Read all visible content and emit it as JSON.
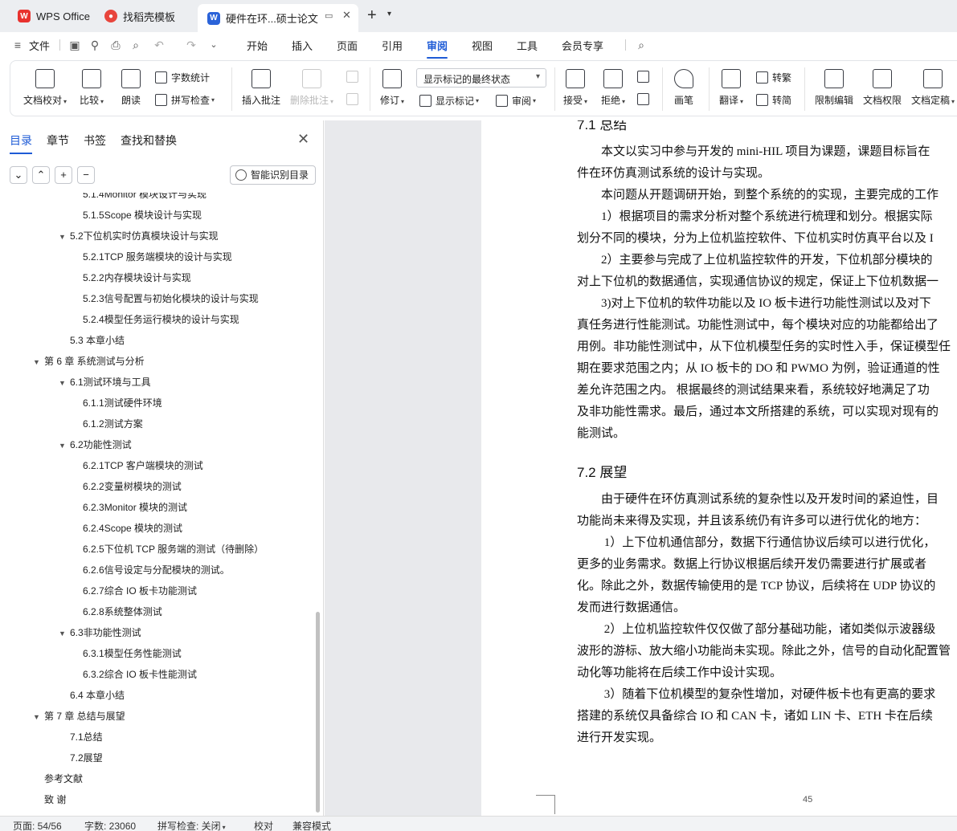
{
  "titlebar": {
    "tabs": [
      {
        "label": "WPS Office",
        "icon": "wps-logo-icon",
        "color": "#e8322e"
      },
      {
        "label": "找稻壳模板",
        "icon": "docer-logo-icon",
        "color": "#e8453c"
      },
      {
        "label": "硬件在环...硕士论文",
        "icon": "word-doc-icon",
        "color": "#2b63d9"
      }
    ],
    "new_tab_glyph": "+"
  },
  "menubar": {
    "file_label": "文件",
    "items": [
      "开始",
      "插入",
      "页面",
      "引用",
      "审阅",
      "视图",
      "工具",
      "会员专享"
    ],
    "active": "审阅"
  },
  "ribbon": {
    "doc_proof": "文档校对",
    "compare": "比较",
    "read_aloud": "朗读",
    "word_count": "字数统计",
    "spell_check": "拼写检查",
    "insert_comment": "插入批注",
    "delete_comment": "删除批注",
    "track_changes": "修订",
    "markup_state": "显示标记的最终状态",
    "show_markup": "显示标记",
    "review": "审阅",
    "accept": "接受",
    "reject": "拒绝",
    "pen": "画笔",
    "translate": "翻译",
    "to_traditional": "转繁",
    "to_simplified": "转简",
    "restrict_edit": "限制编辑",
    "doc_permission": "文档权限",
    "doc_finalize": "文档定稿"
  },
  "nav_pane": {
    "tabs": [
      "目录",
      "章节",
      "书签",
      "查找和替换"
    ],
    "active_tab": "目录",
    "smart_toc_button": "智能识别目录",
    "toc": [
      {
        "text": "5.1.4Monitor 模块设计与实现",
        "level": 3
      },
      {
        "text": "5.1.5Scope 模块设计与实现",
        "level": 3
      },
      {
        "text": "5.2下位机实时仿真模块设计与实现",
        "level": 2,
        "expanded": true
      },
      {
        "text": "5.2.1TCP 服务端模块的设计与实现",
        "level": 3
      },
      {
        "text": "5.2.2内存模块设计与实现",
        "level": 3
      },
      {
        "text": "5.2.3信号配置与初始化模块的设计与实现",
        "level": 3
      },
      {
        "text": "5.2.4模型任务运行模块的设计与实现",
        "level": 3
      },
      {
        "text": "5.3 本章小结",
        "level": 2
      },
      {
        "text": "第 6 章 系统测试与分析",
        "level": 1,
        "expanded": true
      },
      {
        "text": "6.1测试环境与工具",
        "level": 2,
        "expanded": true
      },
      {
        "text": "6.1.1测试硬件环境",
        "level": 3
      },
      {
        "text": "6.1.2测试方案",
        "level": 3
      },
      {
        "text": "6.2功能性测试",
        "level": 2,
        "expanded": true
      },
      {
        "text": "6.2.1TCP 客户端模块的测试",
        "level": 3
      },
      {
        "text": "6.2.2变量树模块的测试",
        "level": 3
      },
      {
        "text": "6.2.3Monitor 模块的测试",
        "level": 3
      },
      {
        "text": "6.2.4Scope 模块的测试",
        "level": 3
      },
      {
        "text": "6.2.5下位机 TCP 服务端的测试（待删除）",
        "level": 3
      },
      {
        "text": "6.2.6信号设定与分配模块的测试。",
        "level": 3
      },
      {
        "text": "6.2.7综合 IO 板卡功能测试",
        "level": 3
      },
      {
        "text": "6.2.8系统整体测试",
        "level": 3
      },
      {
        "text": "6.3非功能性测试",
        "level": 2,
        "expanded": true
      },
      {
        "text": "6.3.1模型任务性能测试",
        "level": 3
      },
      {
        "text": "6.3.2综合 IO 板卡性能测试",
        "level": 3
      },
      {
        "text": "6.4 本章小结",
        "level": 2
      },
      {
        "text": "第 7 章 总结与展望",
        "level": 1,
        "expanded": true
      },
      {
        "text": "7.1总结",
        "level": 2
      },
      {
        "text": "7.2展望",
        "level": 2
      },
      {
        "text": "参考文献",
        "level": 1
      },
      {
        "text": "致 谢",
        "level": 1
      }
    ]
  },
  "document": {
    "lines": [
      {
        "kind": "heading",
        "text": "7.1 总结"
      },
      {
        "kind": "text",
        "text": "　　本文以实习中参与开发的 mini-HIL 项目为课题，课题目标旨在"
      },
      {
        "kind": "text",
        "text": "件在环仿真测试系统的设计与实现。"
      },
      {
        "kind": "text",
        "text": "　　本问题从开题调研开始，到整个系统的的实现，主要完成的工作"
      },
      {
        "kind": "text",
        "text": "　　1）根据项目的需求分析对整个系统进行梳理和划分。根据实际"
      },
      {
        "kind": "text",
        "text": "划分不同的模块，分为上位机监控软件、下位机实时仿真平台以及 I"
      },
      {
        "kind": "text",
        "text": "　　2）主要参与完成了上位机监控软件的开发，下位机部分模块的"
      },
      {
        "kind": "text",
        "text": "对上下位机的数据通信，实现通信协议的规定，保证上下位机数据一"
      },
      {
        "kind": "text",
        "text": "　　3)对上下位机的软件功能以及 IO 板卡进行功能性测试以及对下"
      },
      {
        "kind": "text",
        "text": "真任务进行性能测试。功能性测试中，每个模块对应的功能都给出了"
      },
      {
        "kind": "text",
        "text": "用例。非功能性测试中，从下位机模型任务的实时性入手，保证模型任"
      },
      {
        "kind": "text",
        "text": "期在要求范围之内；从 IO 板卡的 DO 和 PWMO 为例，验证通道的性"
      },
      {
        "kind": "text",
        "text": "差允许范围之内。 根据最终的测试结果来看，系统较好地满足了功"
      },
      {
        "kind": "text",
        "text": "及非功能性需求。最后，通过本文所搭建的系统，可以实现对现有的"
      },
      {
        "kind": "text",
        "text": "能测试。"
      },
      {
        "kind": "heading",
        "text": "7.2 展望"
      },
      {
        "kind": "text",
        "text": "　　由于硬件在环仿真测试系统的复杂性以及开发时间的紧迫性，目"
      },
      {
        "kind": "text",
        "text": "功能尚未来得及实现，并且该系统仍有许多可以进行优化的地方："
      },
      {
        "kind": "text",
        "text": "　　 1）上下位机通信部分，数据下行通信协议后续可以进行优化，"
      },
      {
        "kind": "text",
        "text": "更多的业务需求。数据上行协议根据后续开发仍需要进行扩展或者"
      },
      {
        "kind": "text",
        "text": "化。除此之外，数据传输使用的是 TCP 协议，后续将在 UDP 协议的"
      },
      {
        "kind": "text",
        "text": "发而进行数据通信。"
      },
      {
        "kind": "text",
        "text": "　　 2）上位机监控软件仅仅做了部分基础功能，诸如类似示波器级"
      },
      {
        "kind": "text",
        "text": "波形的游标、放大缩小功能尚未实现。除此之外，信号的自动化配置管"
      },
      {
        "kind": "text",
        "text": "动化等功能将在后续工作中设计实现。"
      },
      {
        "kind": "text",
        "text": "　　 3）随着下位机模型的复杂性增加，对硬件板卡也有更高的要求"
      },
      {
        "kind": "text",
        "text": "搭建的系统仅具备综合 IO 和 CAN 卡，诸如 LIN 卡、ETH 卡在后续"
      },
      {
        "kind": "text",
        "text": "进行开发实现。"
      }
    ],
    "page_number": "45"
  },
  "statusbar": {
    "page": "页面: 54/56",
    "word_count": "字数: 23060",
    "spell_check": "拼写检查: 关闭",
    "proofread": "校对",
    "compat_mode": "兼容模式"
  }
}
